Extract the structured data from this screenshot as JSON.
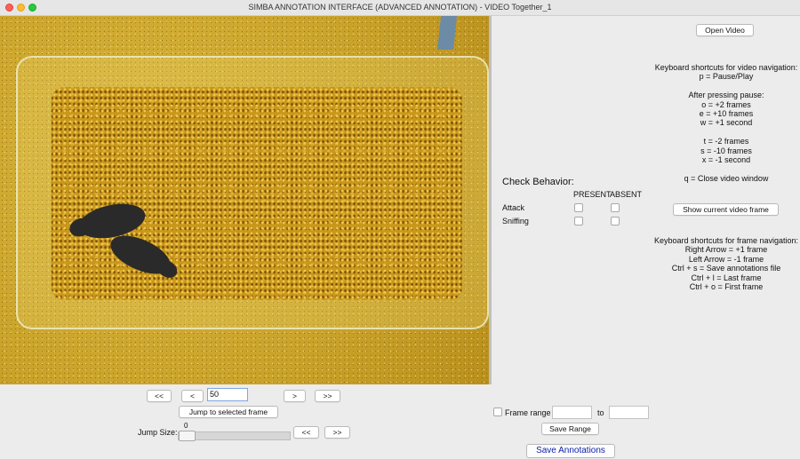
{
  "window": {
    "title": "SIMBA ANNOTATION INTERFACE (ADVANCED ANNOTATION) - VIDEO Together_1"
  },
  "navigation": {
    "first_label": "<<",
    "prev_label": "<",
    "frame_value": "50",
    "next_label": ">",
    "last_label": ">>",
    "jump_button": "Jump to selected frame",
    "jump_size_label": "Jump Size:",
    "jump_size_value": "0",
    "jump_back_label": "<<",
    "jump_forward_label": ">>"
  },
  "right_panel": {
    "open_video": "Open Video",
    "video_shortcuts": [
      "Keyboard shortcuts for video navigation:",
      "p = Pause/Play",
      "",
      "After pressing pause:",
      "o = +2 frames",
      "e = +10 frames",
      "w = +1 second",
      "",
      "t = -2 frames",
      "s = -10 frames",
      "x = -1 second",
      "",
      "q = Close video window"
    ],
    "check_behavior_title": "Check Behavior:",
    "present_header": "PRESENT",
    "absent_header": "ABSENT",
    "behaviors": [
      {
        "name": "Attack",
        "present": false,
        "absent": false
      },
      {
        "name": "Sniffing",
        "present": false,
        "absent": false
      }
    ],
    "show_frame_button": "Show current video frame",
    "frame_shortcuts": [
      "Keyboard shortcuts for frame navigation:",
      "Right Arrow = +1 frame",
      "Left Arrow = -1 frame",
      "Ctrl + s = Save annotations file",
      "Ctrl + l = Last frame",
      "Ctrl + o = First frame"
    ],
    "frame_range_label": "Frame range",
    "frame_range_checked": false,
    "range_from": "",
    "range_to_label": "to",
    "range_to": "",
    "save_range": "Save Range",
    "save_annotations": "Save Annotations"
  },
  "colors": {
    "save_annotations_text": "#0b1fa8",
    "window_bg": "#ececec"
  }
}
